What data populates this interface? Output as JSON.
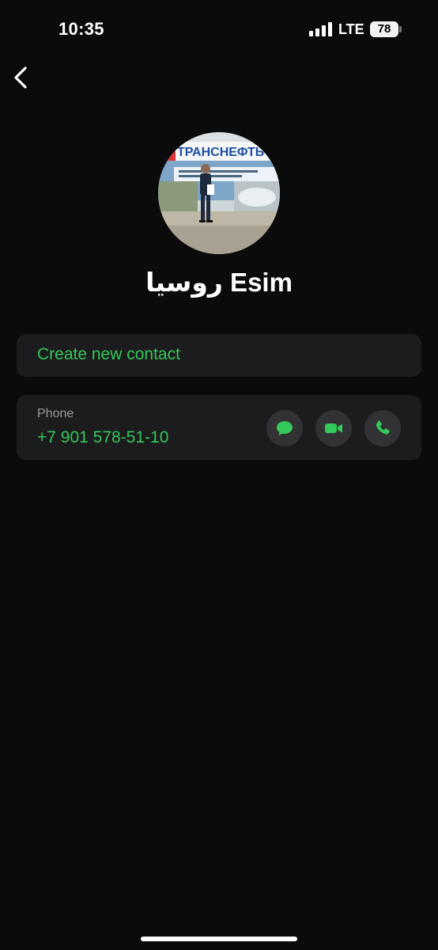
{
  "status_bar": {
    "time": "10:35",
    "network": "LTE",
    "battery": "78",
    "battery_fraction": 0.78
  },
  "header": {
    "back_icon": "chevron-left-icon"
  },
  "contact": {
    "name": "روسيا Esim",
    "avatar_banner_text": "ТРАНСНЕФТЬ"
  },
  "actions": {
    "create_new_contact": "Create new contact"
  },
  "phone": {
    "label": "Phone",
    "number": "+7 901 578-51-10",
    "buttons": [
      {
        "icon": "message-icon"
      },
      {
        "icon": "video-icon"
      },
      {
        "icon": "phone-icon"
      }
    ]
  },
  "colors": {
    "accent": "#34c759",
    "background": "#0b0b0b",
    "card": "#1c1c1e",
    "button": "#323234"
  }
}
